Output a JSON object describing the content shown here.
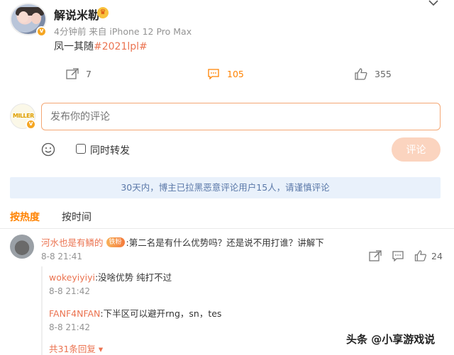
{
  "post": {
    "username": "解说米勒",
    "meta": "4分钟前  来自 iPhone 12 Pro Max",
    "text": "凤一其随",
    "hashtag": "#2021lpl#",
    "repost_count": "7",
    "comment_count": "105",
    "like_count": "355"
  },
  "comment_box": {
    "placeholder": "发布你的评论",
    "repost_label": "同时转发",
    "submit_label": "评论"
  },
  "notice": "30天内，博主已拉黑恶意评论用户15人，请谨慎评论",
  "tabs": {
    "hot": "按热度",
    "time": "按时间"
  },
  "comment": {
    "username": "河水也是有鳞的",
    "fan_badge": "铁粉",
    "text": ":第二名是有什么优势吗？还是说不用打谁？讲解下",
    "time": "8-8 21:41",
    "like_count": "24"
  },
  "replies": [
    {
      "username": "wokeyiyiyi",
      "text": ":没啥优势 纯打不过",
      "time": "8-8 21:42"
    },
    {
      "username": "FANF4NFAN",
      "text": ":下半区可以避开rng，sn，tes",
      "time": "8-8 21:42"
    }
  ],
  "more_replies": "共31条回复",
  "watermark": "头条 @小享游戏说",
  "colors": {
    "accent": "#ff8200",
    "link": "#eb7350",
    "notice_bg": "#e9f1fb",
    "submit_disabled": "#fbd4bf"
  }
}
